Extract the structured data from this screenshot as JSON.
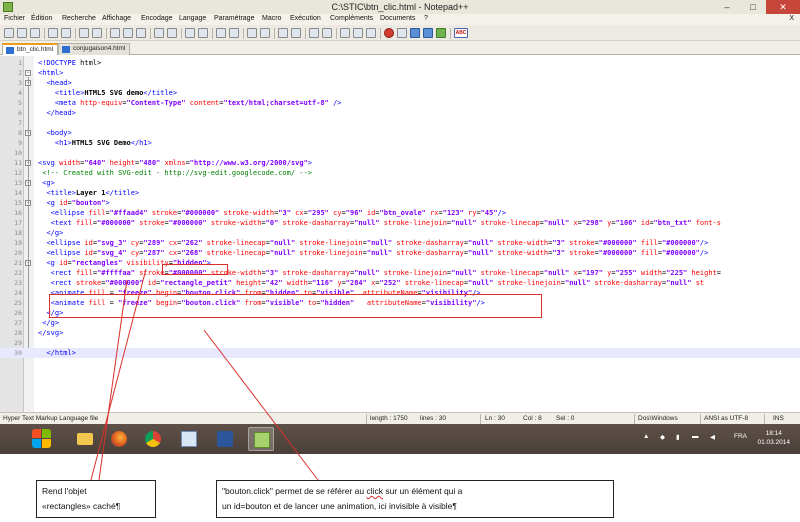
{
  "window": {
    "title": "C:\\STIC\\btn_clic.html - Notepad++",
    "controls": [
      "–",
      "□",
      "✕"
    ]
  },
  "menu": [
    "Fichier",
    "Édition",
    "Recherche",
    "Affichage",
    "Encodage",
    "Langage",
    "Paramétrage",
    "Macro",
    "Exécution",
    "Compléments",
    "Documents",
    "?"
  ],
  "menu_close": "X",
  "toolbar": {
    "icons": [
      "new-icon",
      "open-icon",
      "save-icon",
      "save-all-icon",
      "close-icon",
      "close-all-icon",
      "print-icon",
      "cut-icon",
      "copy-icon",
      "paste-icon",
      "undo-icon",
      "redo-icon",
      "find-icon",
      "replace-icon",
      "zoom-in-icon",
      "zoom-out-icon",
      "sync-v-icon",
      "sync-h-icon",
      "wrap-icon",
      "all-chars-icon",
      "indent-guide-icon",
      "doc-map-icon",
      "func-list-icon",
      "folder-icon",
      "monitor-icon",
      "record-icon",
      "stop-icon",
      "play-icon",
      "play-multi-icon",
      "save-macro-icon",
      "spellcheck-icon"
    ],
    "spellcheck_label": "ABC"
  },
  "tabs": [
    {
      "label": "btn_clic.html",
      "active": true
    },
    {
      "label": "conjugaison4.html",
      "active": false
    }
  ],
  "editor": {
    "current_line": 30,
    "lines": [
      {
        "n": "1",
        "code": "<!DOCTYPE html>"
      },
      {
        "n": "2",
        "code": "<html>"
      },
      {
        "n": "3",
        "code": "  <head>"
      },
      {
        "n": "4",
        "code": "    <title>HTML5 SVG demo</title>"
      },
      {
        "n": "5",
        "code": "    <meta http-equiv=\"Content-Type\" content=\"text/html;charset=utf-8\" />"
      },
      {
        "n": "6",
        "code": "  </head>"
      },
      {
        "n": "7",
        "code": ""
      },
      {
        "n": "8",
        "code": "  <body>"
      },
      {
        "n": "9",
        "code": "    <h1>HTML5 SVG Demo</h1>"
      },
      {
        "n": "10",
        "code": ""
      },
      {
        "n": "11",
        "code": "<svg width=\"640\" height=\"480\" xmlns=\"http://www.w3.org/2000/svg\">"
      },
      {
        "n": "12",
        "code": " <!-- Created with SVG-edit - http://svg-edit.googlecode.com/ -->"
      },
      {
        "n": "13",
        "code": " <g>"
      },
      {
        "n": "14",
        "code": "  <title>Layer 1</title>"
      },
      {
        "n": "15",
        "code": "  <g id=\"bouton\">"
      },
      {
        "n": "16",
        "code": "   <ellipse fill=\"#ffaad4\" stroke=\"#000000\" stroke-width=\"3\" cx=\"295\" cy=\"96\" id=\"btn_ovale\" rx=\"123\" ry=\"45\"/>"
      },
      {
        "n": "17",
        "code": "   <text fill=\"#000000\" stroke=\"#000000\" stroke-width=\"0\" stroke-dasharray=\"null\" stroke-linejoin=\"null\" stroke-linecap=\"null\" x=\"298\" y=\"106\" id=\"btn_txt\" font-s"
      },
      {
        "n": "18",
        "code": "  </g>"
      },
      {
        "n": "19",
        "code": "  <ellipse id=\"svg_3\" cy=\"289\" cx=\"262\" stroke-linecap=\"null\" stroke-linejoin=\"null\" stroke-dasharray=\"null\" stroke-width=\"3\" stroke=\"#000000\" fill=\"#000000\"/>"
      },
      {
        "n": "20",
        "code": "  <ellipse id=\"svg_4\" cy=\"287\" cx=\"268\" stroke-linecap=\"null\" stroke-linejoin=\"null\" stroke-dasharray=\"null\" stroke-width=\"3\" stroke=\"#000000\" fill=\"#000000\"/>"
      },
      {
        "n": "21",
        "code": "  <g id=\"rectangles\" visibility=\"hidden\">"
      },
      {
        "n": "22",
        "code": "   <rect fill=\"#ffffaa\" stroke=\"#000000\" stroke-width=\"3\" stroke-dasharray=\"null\" stroke-linejoin=\"null\" stroke-linecap=\"null\" x=\"197\" y=\"255\" width=\"225\" height="
      },
      {
        "n": "23",
        "code": "   <rect stroke=\"#000000\" id=\"rectangle_petit\" height=\"42\" width=\"116\" y=\"284\" x=\"252\" stroke-linecap=\"null\" stroke-linejoin=\"null\" stroke-dasharray=\"null\" st"
      },
      {
        "n": "24",
        "code": "   <animate fill = \"freeze\" begin=\"bouton.click\" from=\"hidden\" to=\"visible\"  attributeName=\"visibility\"/>"
      },
      {
        "n": "25",
        "code": "   <animate fill = \"freeze\" begin=\"bouton.click\" from=\"visible\" to=\"hidden\"   attributeName=\"visibility\"/>"
      },
      {
        "n": "26",
        "code": "  </g>"
      },
      {
        "n": "27",
        "code": " </g>"
      },
      {
        "n": "28",
        "code": "</svg>"
      },
      {
        "n": "29",
        "code": ""
      },
      {
        "n": "30",
        "code": "  </html>"
      }
    ]
  },
  "status": {
    "language": "Hyper Text Markup Language file",
    "length": "length : 1750",
    "lines": "lines : 30",
    "ln": "Ln : 30",
    "col": "Col : 8",
    "sel": "Sel : 0",
    "eol": "Dos\\Windows",
    "encoding": "ANSI as UTF-8",
    "mode": "INS"
  },
  "taskbar": {
    "apps": [
      "explorer-icon",
      "firefox-icon",
      "chrome-icon",
      "notepad-icon",
      "word-icon",
      "notepadpp-icon"
    ],
    "lang": "FRA",
    "time": "18:14",
    "date": "01.03.2014"
  },
  "annotations": {
    "left": {
      "line1": "Rend l'objet",
      "line2": "«rectangles» caché¶"
    },
    "right": {
      "line1": "\"bouton.click\" permet de se référer au click sur un élément qui a",
      "line2": "un id=bouton et de lancer une animation, ici invisible à visible¶"
    }
  },
  "colors": {
    "highlight_box": "#d9302a",
    "tag": "#0000ff",
    "attribute": "#ff0000",
    "value": "#8000ff",
    "comment": "#008000"
  }
}
